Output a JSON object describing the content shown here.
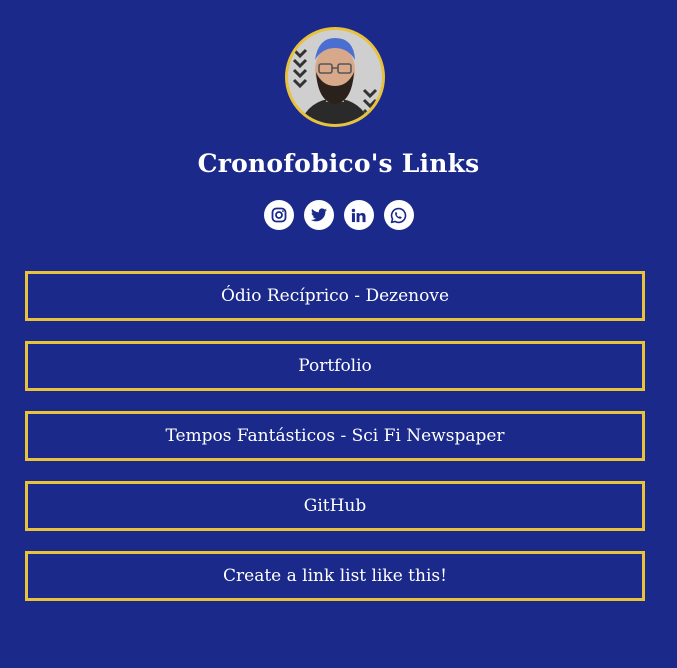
{
  "profile": {
    "name": "Cronofobico's Links",
    "avatar_icon": "profile-photo"
  },
  "socials": [
    {
      "icon": "instagram-icon"
    },
    {
      "icon": "twitter-icon"
    },
    {
      "icon": "linkedin-icon"
    },
    {
      "icon": "whatsapp-icon"
    }
  ],
  "links": [
    {
      "label": "Ódio Recíprico - Dezenove"
    },
    {
      "label": "Portfolio"
    },
    {
      "label": "Tempos Fantásticos - Sci Fi Newspaper"
    },
    {
      "label": "GitHub"
    },
    {
      "label": "Create a link list like this!"
    }
  ],
  "colors": {
    "background": "#1b2a8a",
    "accent": "#e8c23a",
    "text": "#ffffff",
    "icon": "#1b2a8a"
  }
}
